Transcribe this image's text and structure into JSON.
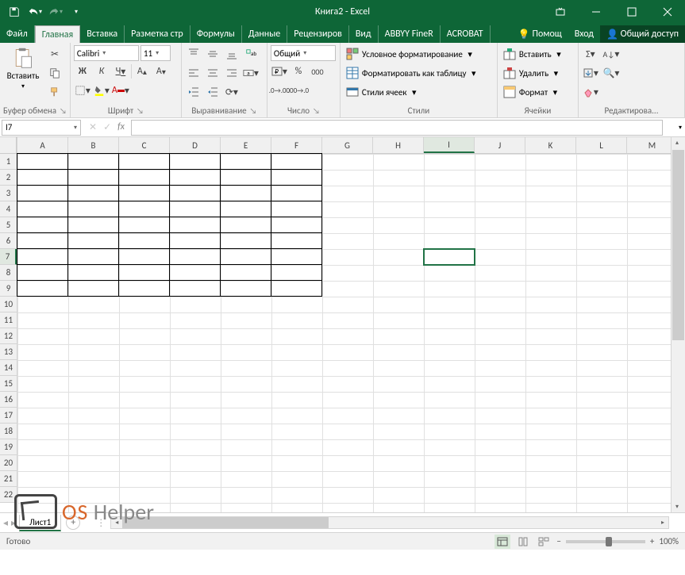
{
  "title": "Книга2 - Excel",
  "qat": {
    "save": "save",
    "undo": "undo",
    "redo": "redo"
  },
  "tabs": {
    "file": "Файл",
    "list": [
      "Главная",
      "Вставка",
      "Разметка стр",
      "Формулы",
      "Данные",
      "Рецензиров",
      "Вид",
      "ABBYY FineR",
      "ACROBAT"
    ],
    "active": 0,
    "help": "Помощ",
    "login": "Вход",
    "share": "Общий доступ"
  },
  "ribbon": {
    "clipboard": {
      "label": "Буфер обмена",
      "paste": "Вставить"
    },
    "font": {
      "label": "Шрифт",
      "name": "Calibri",
      "size": "11",
      "bold": "Ж",
      "italic": "К",
      "underline": "Ч"
    },
    "alignment": {
      "label": "Выравнивание"
    },
    "number": {
      "label": "Число",
      "format": "Общий"
    },
    "styles": {
      "label": "Стили",
      "conditional": "Условное форматирование",
      "table": "Форматировать как таблицу",
      "cellstyles": "Стили ячеек"
    },
    "cells": {
      "label": "Ячейки",
      "insert": "Вставить",
      "delete": "Удалить",
      "format": "Формат"
    },
    "editing": {
      "label": "Редактирова..."
    }
  },
  "namebox": "I7",
  "formula": "",
  "columns": [
    "A",
    "B",
    "C",
    "D",
    "E",
    "F",
    "G",
    "H",
    "I",
    "J",
    "K",
    "L",
    "M"
  ],
  "selected_col": "I",
  "rows": 22,
  "selected_row": 7,
  "bordered_range": {
    "cols_from": 0,
    "cols_to": 5,
    "rows_from": 0,
    "rows_to": 8
  },
  "sheet": {
    "name": "Лист1"
  },
  "status": {
    "ready": "Готово",
    "zoom": "100%"
  },
  "watermark": {
    "os": "OS",
    "helper": "Helper"
  }
}
